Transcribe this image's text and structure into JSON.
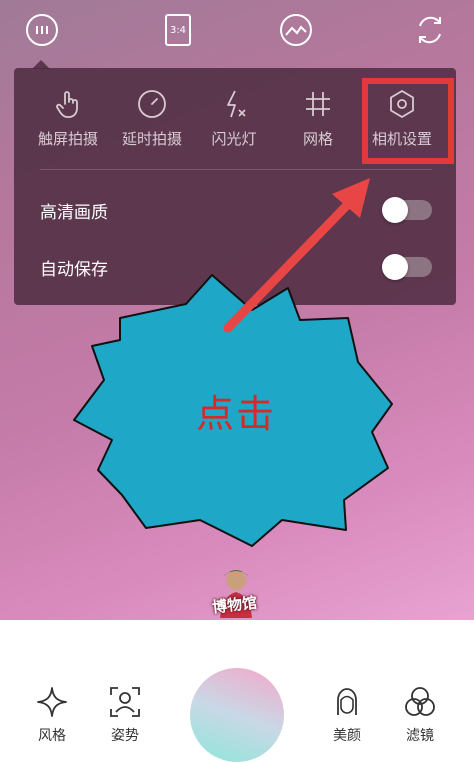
{
  "topbar": {
    "icons": [
      "more-icon",
      "aspect-ratio-icon",
      "scene-icon",
      "switch-camera-icon"
    ],
    "aspect_label": "3:4"
  },
  "menu": {
    "options": [
      {
        "label": "触屏拍摄",
        "icon": "touch-shoot-icon"
      },
      {
        "label": "延时拍摄",
        "icon": "timer-icon"
      },
      {
        "label": "闪光灯",
        "icon": "flash-off-icon"
      },
      {
        "label": "网格",
        "icon": "grid-icon"
      },
      {
        "label": "相机设置",
        "icon": "settings-icon"
      }
    ],
    "toggles": [
      {
        "label": "高清画质",
        "state": "off"
      },
      {
        "label": "自动保存",
        "state": "off"
      }
    ]
  },
  "annotation": {
    "callout_text": "点击",
    "colors": {
      "highlight": "#e23a3a",
      "bubble": "#1fa7c8",
      "callout_text": "#d62a2a"
    }
  },
  "watermark": {
    "text": "博物馆"
  },
  "bottom": {
    "left_items": [
      {
        "label": "风格",
        "icon": "style-icon"
      },
      {
        "label": "姿势",
        "icon": "pose-icon"
      }
    ],
    "right_items": [
      {
        "label": "美颜",
        "icon": "beauty-icon"
      },
      {
        "label": "滤镜",
        "icon": "filter-icon"
      }
    ]
  }
}
